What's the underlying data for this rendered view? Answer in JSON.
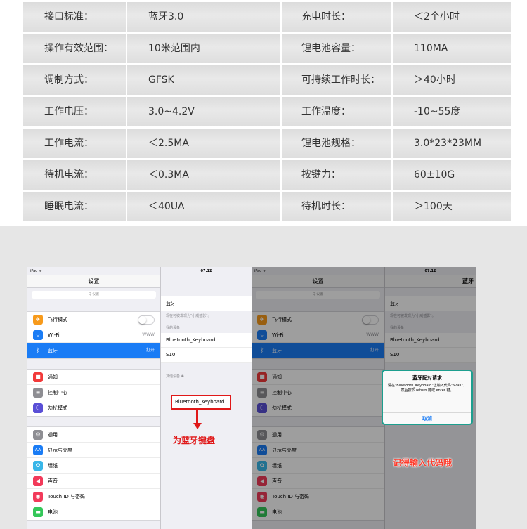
{
  "specs": [
    {
      "k1": "接口标准：",
      "v1": "蓝牙3.0",
      "k2": "充电时长：",
      "v2": "＜2个小时"
    },
    {
      "k1": "操作有效范围：",
      "v1": "10米范围内",
      "k2": "锂电池容量：",
      "v2": "110MA"
    },
    {
      "k1": "调制方式：",
      "v1": "GFSK",
      "k2": "可持续工作时长：",
      "v2": "＞40小时"
    },
    {
      "k1": "工作电压：",
      "v1": "3.0~4.2V",
      "k2": "工作温度：",
      "v2": "-10~55度"
    },
    {
      "k1": "工作电流：",
      "v1": "＜2.5MA",
      "k2": "锂电池规格：",
      "v2": "3.0*23*23MM"
    },
    {
      "k1": "待机电流：",
      "v1": "＜0.3MA",
      "k2": "按键力：",
      "v2": "60±10G"
    },
    {
      "k1": "睡眠电流：",
      "v1": "＜40UA",
      "k2": "待机时长：",
      "v2": "＞100天"
    }
  ],
  "ipad": {
    "status": "iPad ᯤ",
    "time": "07:12",
    "settings_title": "设置",
    "search_placeholder": "Q 设置",
    "airplane": "飞行模式",
    "wifi": "Wi-Fi",
    "wifi_value": "WWW",
    "bluetooth": "蓝牙",
    "bluetooth_value": "打开",
    "notifications": "通知",
    "control_center": "控制中心",
    "dnd": "勿扰模式",
    "general": "通用",
    "display": "显示与亮度",
    "wallpaper": "墙纸",
    "sounds": "声音",
    "touchid": "Touch ID 与密码",
    "battery": "电池"
  },
  "detail": {
    "bt_title": "蓝牙",
    "bt_label": "蓝牙",
    "discoverable": "现在可被发现为\"小威插影\"。",
    "my_devices": "我的设备",
    "device1": "Bluetooth_Keyboard",
    "device2": "S10",
    "other_devices": "其他设备",
    "other_device": "Bluetooth_Keyboard"
  },
  "annotations": {
    "for_keyboard": "为蓝牙键盘",
    "remember_code": "记得输入代码哦"
  },
  "dialog": {
    "title": "蓝牙配对请求",
    "message": "请在\"Bluetooth_Keyboard\"上输入代码\"6791\"，然后按下 return 键或 enter 键。",
    "cancel": "取消"
  },
  "colors": {
    "accent_blue": "#1a7cf5",
    "red": "#e01818",
    "dialog_border": "#1d9f8f"
  }
}
